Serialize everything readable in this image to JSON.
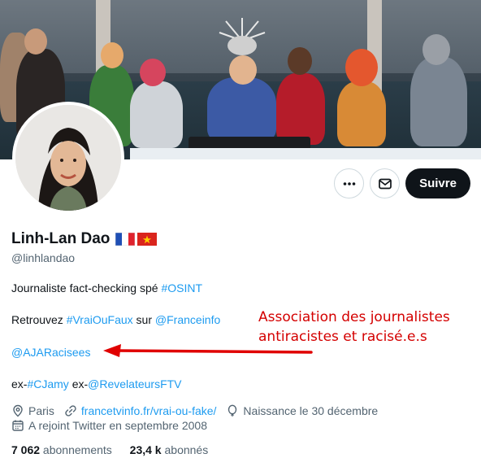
{
  "profile": {
    "name": "Linh-Lan Dao",
    "handle": "@linhlandao",
    "flags": [
      "france-flag",
      "vietnam-flag"
    ],
    "follow_label": "Suivre",
    "more_icon": "more-icon",
    "message_icon": "mail-icon"
  },
  "bio": {
    "line1_text": "Journaliste fact-checking spé ",
    "line1_tag": "#OSINT",
    "line2_prefix": "Retrouvez ",
    "line2_tag": "#VraiOuFaux",
    "line2_mid": " sur ",
    "line2_mention": "@Franceinfo",
    "line3_mention": "@AJARacisees",
    "line4_ex1": "ex-",
    "line4_tag": "#CJamy",
    "line4_ex2": " ex-",
    "line4_mention": "@RevelateursFTV"
  },
  "meta": {
    "location": "Paris",
    "website": "francetvinfo.fr/vrai-ou-fake/",
    "birthday": "Naissance le 30 décembre",
    "joined": "A rejoint Twitter en septembre 2008"
  },
  "stats": {
    "following_count": "7 062",
    "following_label": " abonnements",
    "followers_count": "23,4 k",
    "followers_label": " abonnés"
  },
  "annotation": {
    "line1": "Association des journalistes",
    "line2": "antiracistes et racisé.e.s",
    "color": "#d40000"
  },
  "colors": {
    "link": "#1d9bf0",
    "text": "#0f1419",
    "muted": "#536471",
    "button": "#0f1419"
  }
}
